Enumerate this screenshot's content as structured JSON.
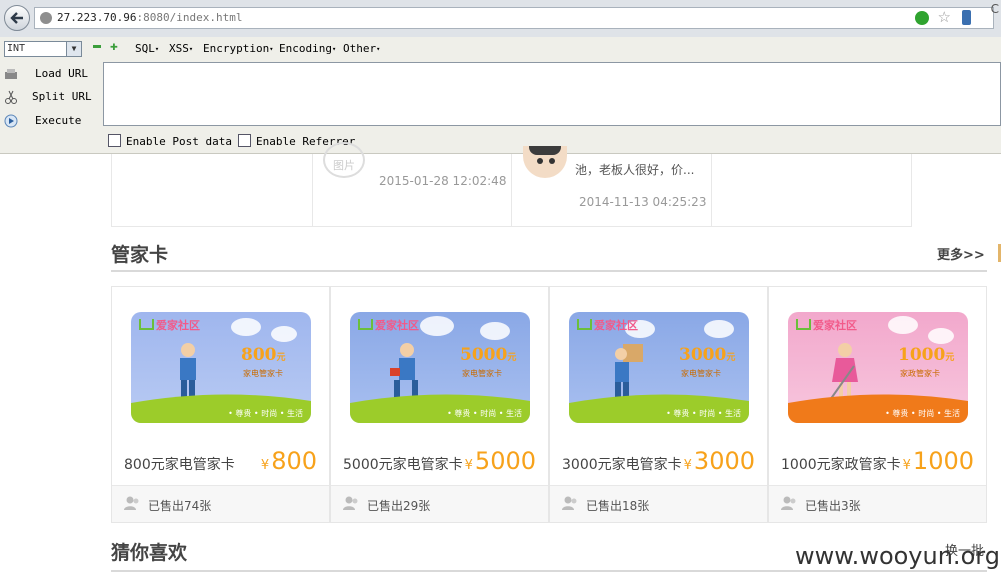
{
  "browser": {
    "url_host": "27.223.70.96",
    "url_rest": ":8080/index.html"
  },
  "hackbar": {
    "type_select": "INT",
    "menus": [
      "SQL",
      "XSS",
      "Encryption",
      "Encoding",
      "Other"
    ],
    "buttons": {
      "load_url": "Load URL",
      "split_url": "Split URL",
      "execute": "Execute"
    },
    "url_box_value": "",
    "checkboxes": {
      "post_data": "Enable Post data",
      "referrer": "Enable Referrer"
    }
  },
  "page": {
    "top_row": {
      "image_placeholder": "图片",
      "date_1": "2015-01-28 12:02:48",
      "comment": "池，老板人很好，价...",
      "date_2": "2014-11-13 04:25:23"
    },
    "butler_section": {
      "title": "管家卡",
      "more": "更多>>"
    },
    "cards": [
      {
        "name": "800元家电管家卡",
        "price": "800",
        "amount_on_card": "800",
        "type_on_card": "家电管家卡",
        "sold": "已售出74张"
      },
      {
        "name": "5000元家电管家卡",
        "price": "5000",
        "amount_on_card": "5000",
        "type_on_card": "家电管家卡",
        "sold": "已售出29张"
      },
      {
        "name": "3000元家电管家卡",
        "price": "3000",
        "amount_on_card": "3000",
        "type_on_card": "家电管家卡",
        "sold": "已售出18张"
      },
      {
        "name": "1000元家政管家卡",
        "price": "1000",
        "amount_on_card": "1000",
        "type_on_card": "家政管家卡",
        "sold": "已售出3张"
      }
    ],
    "card_common": {
      "logo": "爱家社区",
      "yuan": "元",
      "slogan": "• 尊贵 • 时尚 • 生活",
      "currency": "¥"
    },
    "guess_section": {
      "title": "猜你喜欢",
      "refresh": "换一批"
    },
    "watermark": "www.wooyun.org"
  },
  "colors": {
    "price_orange": "#f7a21b",
    "card_blue_bg": "#8aa8e6",
    "card_pink_bg": "#f4b7d6",
    "grass_green": "#9ccc2a",
    "grass_orange": "#f07a1a"
  }
}
